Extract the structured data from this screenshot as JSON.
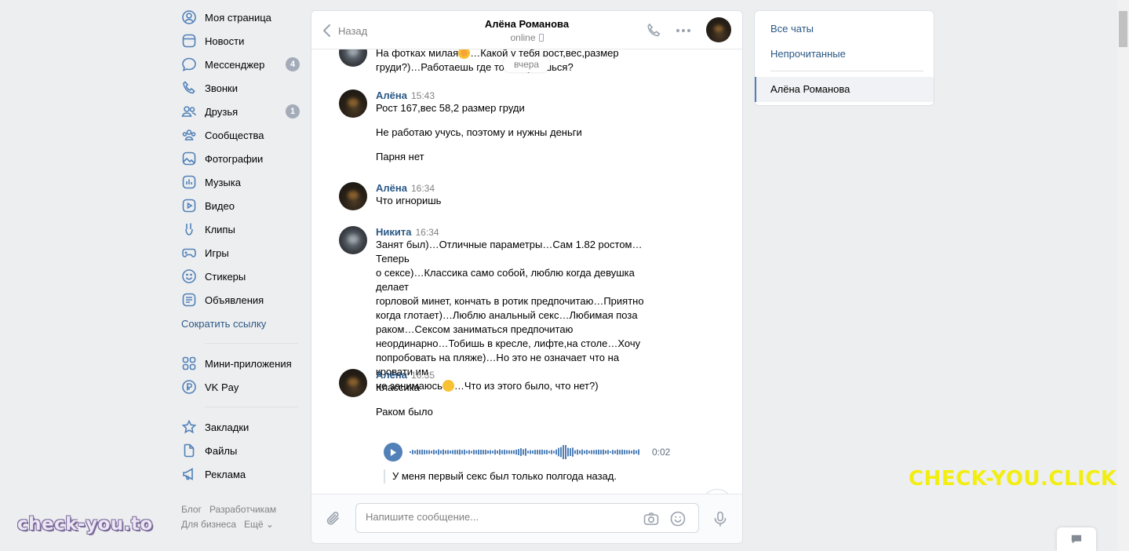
{
  "nav": {
    "items": [
      {
        "label": "Моя страница",
        "icon": "user-icon"
      },
      {
        "label": "Новости",
        "icon": "newsfeed-icon"
      },
      {
        "label": "Мессенджер",
        "icon": "message-icon",
        "badge": "4"
      },
      {
        "label": "Звонки",
        "icon": "phone-icon"
      },
      {
        "label": "Друзья",
        "icon": "friends-icon",
        "badge": "1"
      },
      {
        "label": "Сообщества",
        "icon": "communities-icon"
      },
      {
        "label": "Фотографии",
        "icon": "photo-icon"
      },
      {
        "label": "Музыка",
        "icon": "music-icon"
      },
      {
        "label": "Видео",
        "icon": "video-icon"
      },
      {
        "label": "Клипы",
        "icon": "clips-icon"
      },
      {
        "label": "Игры",
        "icon": "gamepad-icon"
      },
      {
        "label": "Стикеры",
        "icon": "smile-icon"
      },
      {
        "label": "Объявления",
        "icon": "classifieds-icon"
      }
    ],
    "shorten_link": "Сократить ссылку",
    "apps": [
      {
        "label": "Мини-приложения",
        "icon": "apps-icon"
      },
      {
        "label": "VK Pay",
        "icon": "vkpay-icon"
      }
    ],
    "extra": [
      {
        "label": "Закладки",
        "icon": "star-icon"
      },
      {
        "label": "Файлы",
        "icon": "file-icon"
      },
      {
        "label": "Реклама",
        "icon": "megaphone-icon"
      }
    ],
    "footer": {
      "blog": "Блог",
      "devs": "Разработчикам",
      "business": "Для бизнеса",
      "more": "Ещё ⌄"
    }
  },
  "chat": {
    "back_label": "Назад",
    "peer_name": "Алёна Романова",
    "peer_status": "online",
    "date_divider": "вчера",
    "messages": [
      {
        "author": "",
        "time": "",
        "text_parts": [
          "На фотках милая",
          "…Какой у тебя рост,вес,размер\nгруди?)…Работаешь где то или учишься?"
        ]
      },
      {
        "author": "Алёна",
        "time": "15:43",
        "lines": [
          "Рост 167,вес 58,2 размер груди",
          "Не работаю учусь, поэтому и нужны деньги",
          "Парня нет"
        ]
      },
      {
        "author": "Алёна",
        "time": "16:34",
        "text": "Что игноришь"
      },
      {
        "author": "Никита",
        "time": "16:34",
        "text_parts": [
          "Занят был)…Отличные параметры…Сам 1.82 ростом…Теперь\nо сексе)…Классика само собой, люблю когда девушка делает\nгорловой минет, кончать в ротик предпочитаю…Приятно\nкогда глотает)…Люблю анальный секс…Любимая поза\nраком…Сексом заниматься предпочитаю\nнеординарно…Тобишь в кресле, лифте,на столе…Хочу\nпопробовать на пляже)…Но это не означает что на кровати им\nне занимаюсь",
          "…Что из этого было, что нет?)"
        ]
      },
      {
        "author": "Алёна",
        "time": "16:35",
        "lines": [
          "Классика",
          "Раком было"
        ]
      }
    ],
    "voice": {
      "duration": "0:02",
      "transcript": "У меня первый секс был только полгода назад."
    },
    "composer_placeholder": "Напишите сообщение..."
  },
  "right_panel": {
    "all_chats": "Все чаты",
    "unread": "Непрочитанные",
    "active_chat": "Алёна Романова"
  },
  "watermarks": {
    "left": "check-you.to",
    "right": "CHECK-YOU.CLICK"
  },
  "colors": {
    "link": "#2a5885",
    "accent": "#5181b8",
    "background": "#edeef0",
    "badge": "#a3acb8",
    "watermark_right": "#f2ee12"
  }
}
